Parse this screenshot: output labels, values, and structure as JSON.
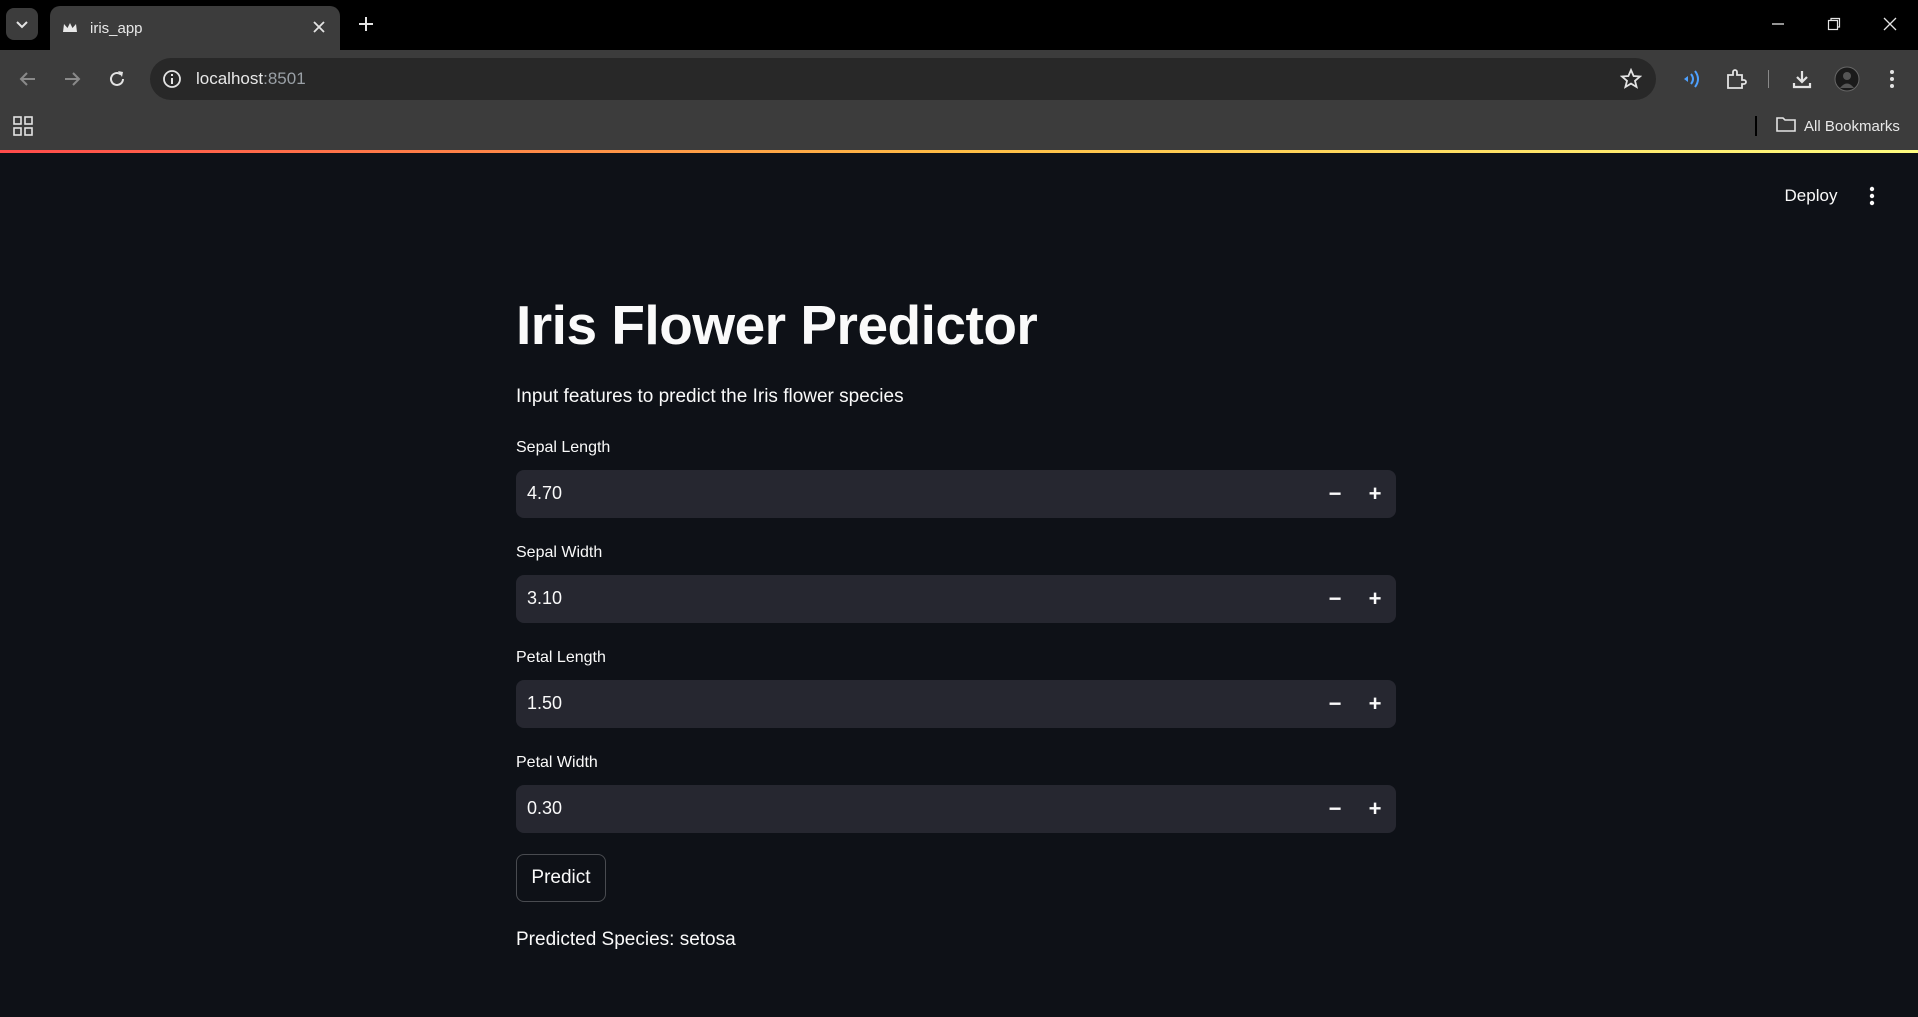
{
  "browser": {
    "tab_title": "iris_app",
    "url_host": "localhost",
    "url_port": ":8501",
    "all_bookmarks_label": "All Bookmarks"
  },
  "app": {
    "deploy_label": "Deploy",
    "title": "Iris Flower Predictor",
    "subtitle": "Input features to predict the Iris flower species",
    "fields": [
      {
        "label": "Sepal Length",
        "value": "4.70"
      },
      {
        "label": "Sepal Width",
        "value": "3.10"
      },
      {
        "label": "Petal Length",
        "value": "1.50"
      },
      {
        "label": "Petal Width",
        "value": "0.30"
      }
    ],
    "minus_symbol": "−",
    "plus_symbol": "+",
    "predict_label": "Predict",
    "result_text": "Predicted Species: setosa"
  },
  "colors": {
    "background": "#0e1117",
    "input_background": "#262730",
    "text": "#fafafa",
    "accent_gradient_start": "#ff4b4b",
    "accent_gradient_end": "#fffd80"
  },
  "icons": [
    "tab-search-icon",
    "streamlit-crown-icon",
    "close-icon",
    "plus-icon",
    "minimize-icon",
    "restore-icon",
    "back-icon",
    "forward-icon",
    "reload-icon",
    "site-info-icon",
    "star-icon",
    "media-icon",
    "extensions-icon",
    "download-icon",
    "profile-icon",
    "more-vert-icon",
    "apps-icon",
    "folder-icon"
  ]
}
